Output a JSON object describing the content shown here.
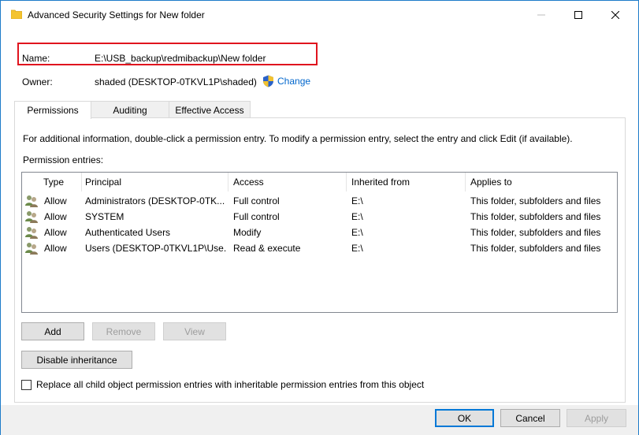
{
  "window": {
    "title": "Advanced Security Settings for New folder",
    "minimize_glyph": "—",
    "maximize_glyph": "☐",
    "close_glyph": "✕"
  },
  "header": {
    "name_label": "Name:",
    "name_value": "E:\\USB_backup\\redmibackup\\New folder",
    "owner_label": "Owner:",
    "owner_value": "shaded (DESKTOP-0TKVL1P\\shaded)",
    "change_link": "Change"
  },
  "tabs": [
    {
      "label": "Permissions",
      "active": true
    },
    {
      "label": "Auditing",
      "active": false
    },
    {
      "label": "Effective Access",
      "active": false
    }
  ],
  "permissions": {
    "info_text": "For additional information, double-click a permission entry. To modify a permission entry, select the entry and click Edit (if available).",
    "entries_label": "Permission entries:",
    "columns": [
      "Type",
      "Principal",
      "Access",
      "Inherited from",
      "Applies to"
    ],
    "rows": [
      {
        "type": "Allow",
        "principal": "Administrators (DESKTOP-0TK...",
        "access": "Full control",
        "inherited_from": "E:\\",
        "applies_to": "This folder, subfolders and files"
      },
      {
        "type": "Allow",
        "principal": "SYSTEM",
        "access": "Full control",
        "inherited_from": "E:\\",
        "applies_to": "This folder, subfolders and files"
      },
      {
        "type": "Allow",
        "principal": "Authenticated Users",
        "access": "Modify",
        "inherited_from": "E:\\",
        "applies_to": "This folder, subfolders and files"
      },
      {
        "type": "Allow",
        "principal": "Users (DESKTOP-0TKVL1P\\Use...",
        "access": "Read & execute",
        "inherited_from": "E:\\",
        "applies_to": "This folder, subfolders and files"
      }
    ],
    "add_button": "Add",
    "remove_button": "Remove",
    "view_button": "View",
    "disable_inheritance_button": "Disable inheritance",
    "replace_checkbox_label": "Replace all child object permission entries with inheritable permission entries from this object",
    "replace_checked": false
  },
  "footer": {
    "ok_button": "OK",
    "cancel_button": "Cancel",
    "apply_button": "Apply"
  },
  "colors": {
    "accent": "#0078d7",
    "link": "#0066cc",
    "highlight_border": "#e0141e",
    "folder": "#f4c430"
  }
}
